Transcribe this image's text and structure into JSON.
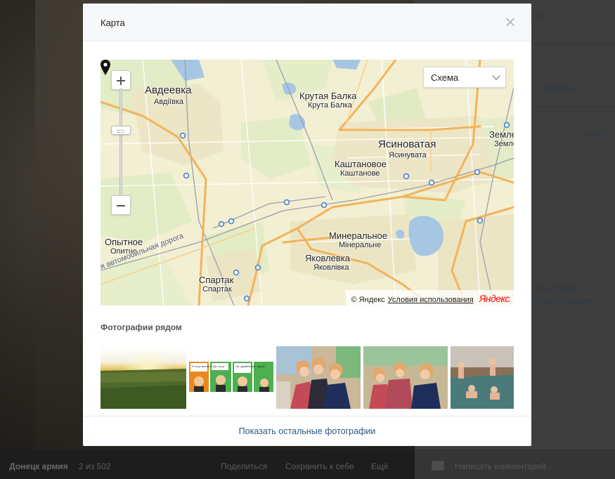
{
  "background": {
    "album_name": "Донецк армия",
    "counter": "2 из 502",
    "actions": [
      "Поделиться",
      "Сохранить к себе",
      "Ещё"
    ],
    "right_texts": {
      "top": "ов",
      "location": "е, Украина",
      "top_right": "Земл",
      "comment_hint_1": "кто оставит",
      "comment_hint_2": "ой фотографии."
    },
    "comment_placeholder": "Написать комментарий..."
  },
  "modal": {
    "title": "Карта",
    "close_icon": "close-icon"
  },
  "map": {
    "layer_selected": "Схема",
    "labels": {
      "avdeevka": "Авдеевка",
      "avdeevka_ua": "Авдіївка",
      "krutaya": "Крутая Балка",
      "krutaya_ua": "Крута Балка",
      "yasin": "Ясиноватая",
      "yasin_ua": "Ясинувата",
      "kasht": "Каштановое",
      "kasht_ua": "Каштанове",
      "zeml": "Земле",
      "zeml_ua": "Земле",
      "min": "Минеральное",
      "min_ua": "Мінеральне",
      "opyt": "Опытное",
      "opyt_ua": "Опитне",
      "yakov": "Яковлевка",
      "yakov_ua": "Яковлівка",
      "spartak": "Спартак",
      "spartak_ua": "Спартак",
      "road": "я автомобильная дорога"
    },
    "copyright": "© Яндекс",
    "terms_link": "Условия использования",
    "logo_text": "Яндекс"
  },
  "photos": {
    "title": "Фотографии рядом",
    "show_more": "Показать остальные фотографии",
    "comic_bubbles": [
      "Я хочу звонить!",
      "Да, хочу!",
      "Не, давайте вот здесь!"
    ]
  }
}
